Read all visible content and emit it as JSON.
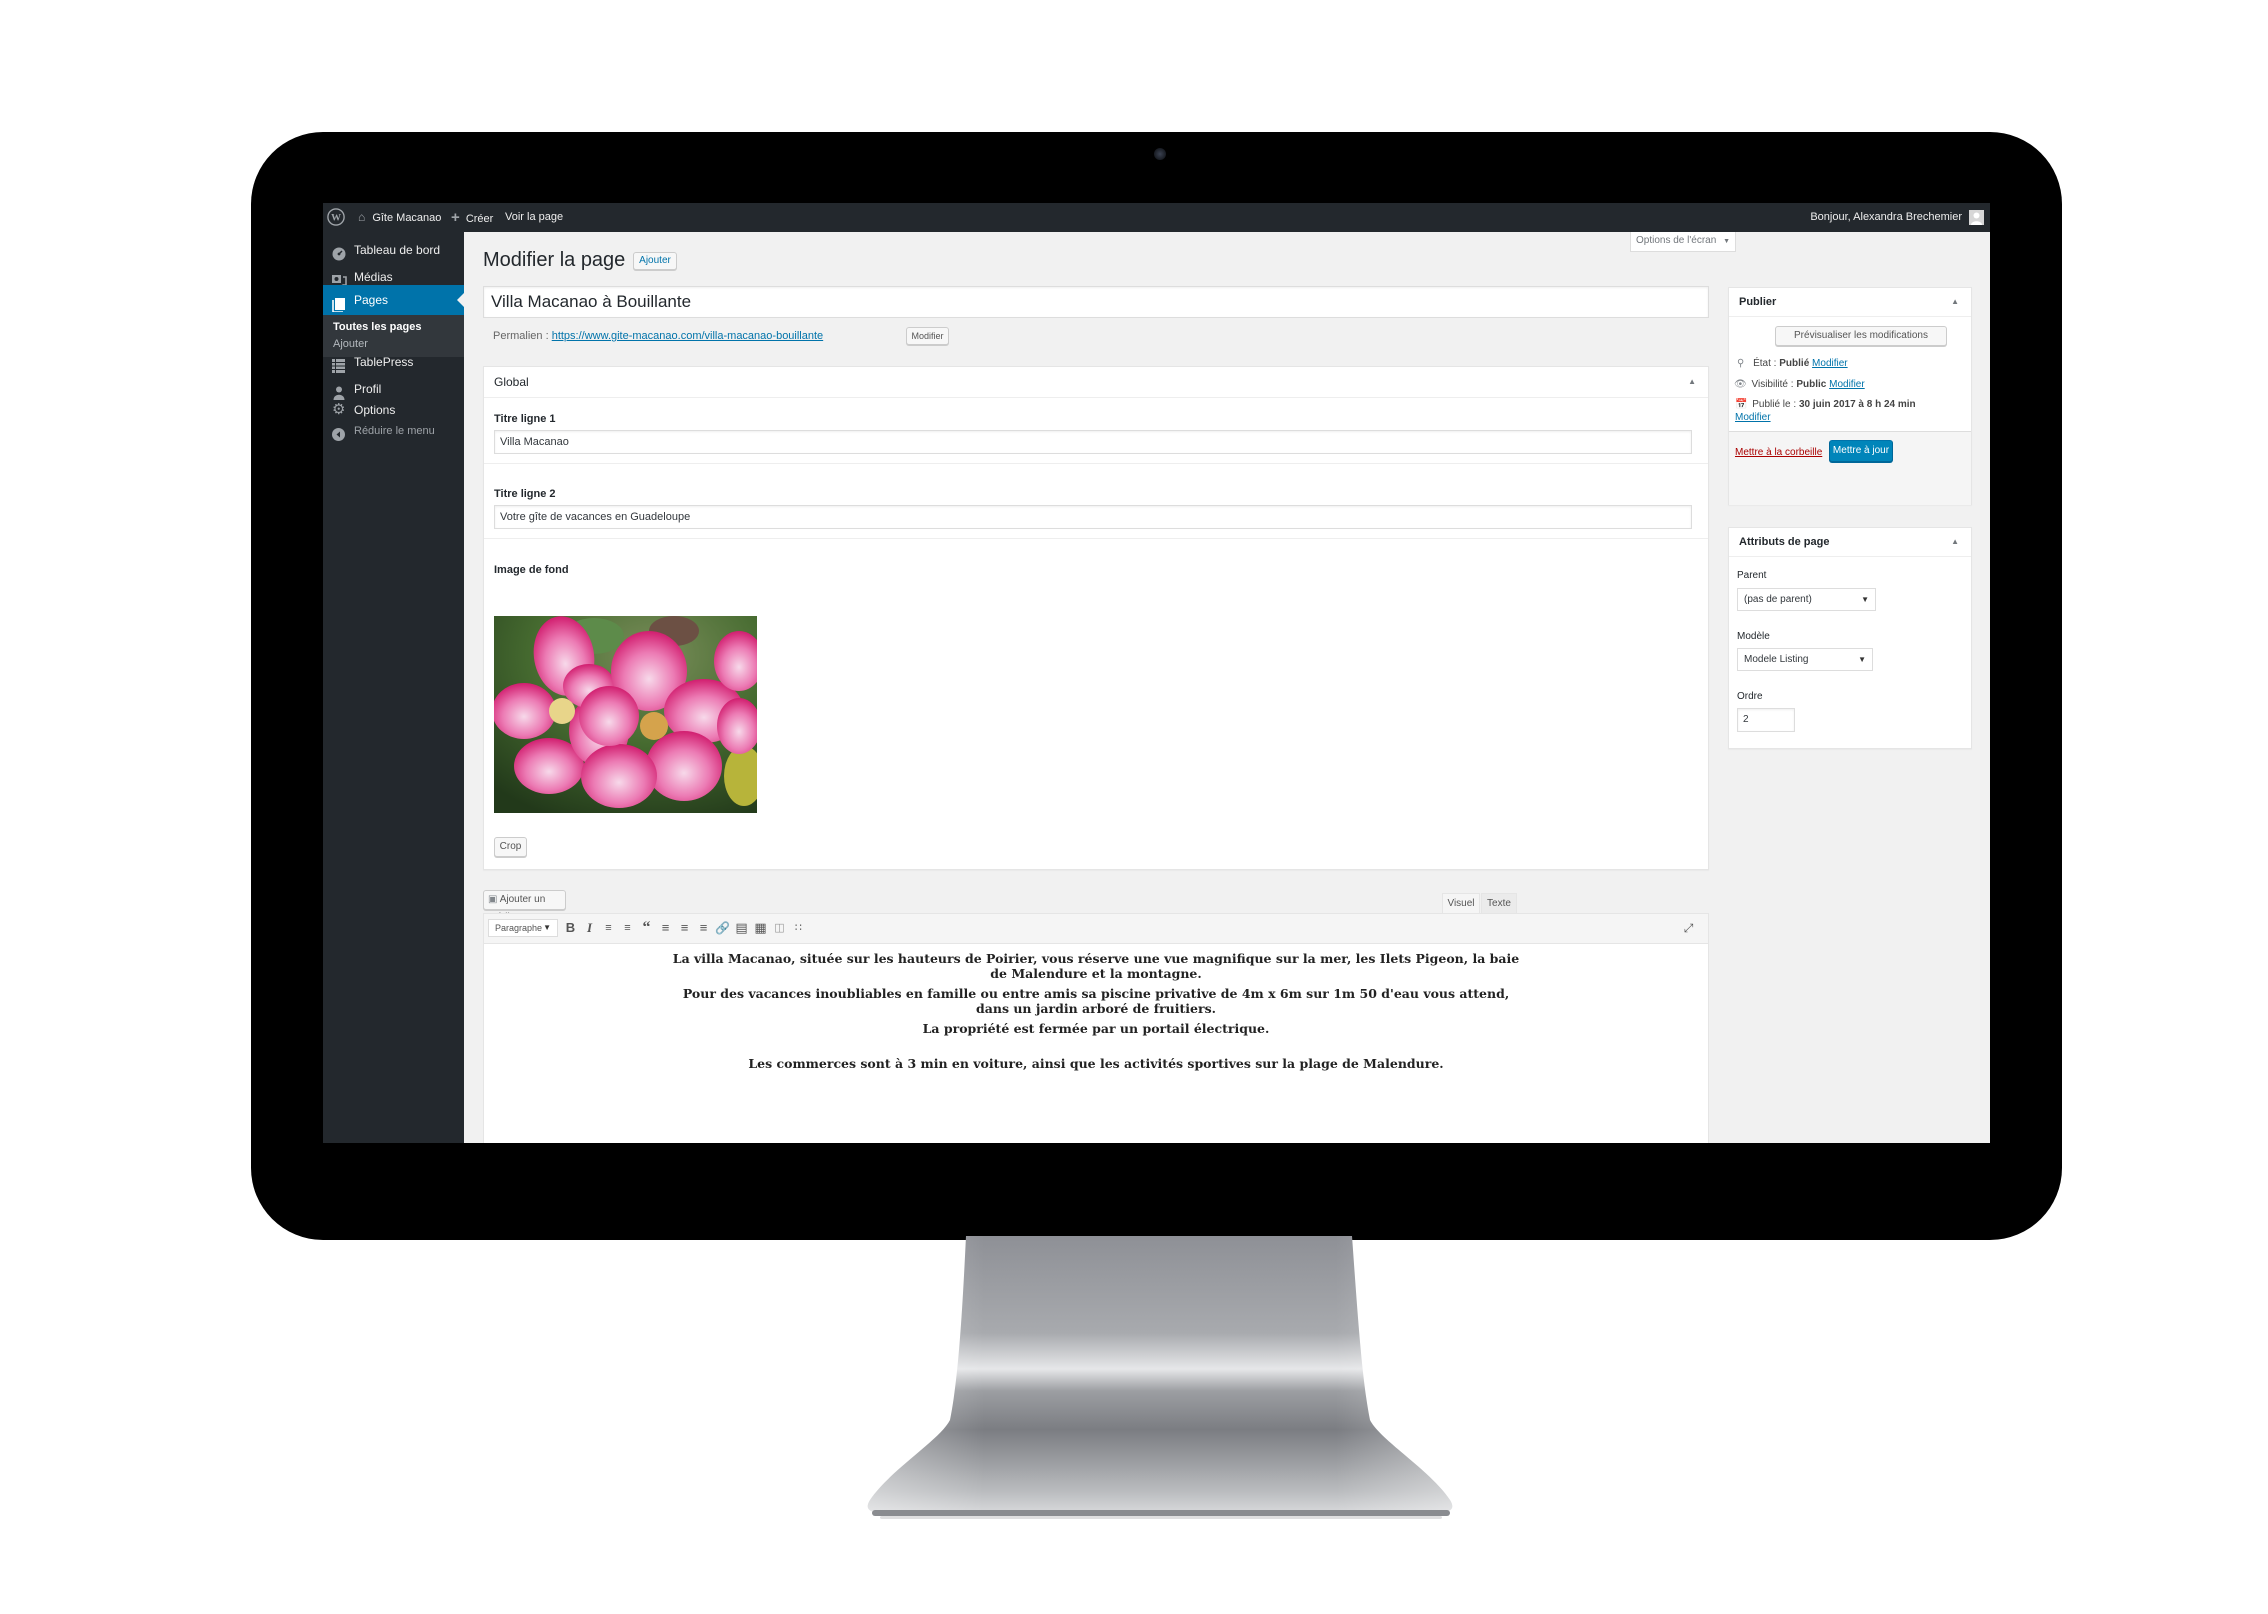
{
  "adminbar": {
    "site_name": "Gîte Macanao",
    "new_label": "Créer",
    "view_page": "Voir la page",
    "greeting": "Bonjour, Alexandra Brechemier",
    "icons": [
      "wordpress-logo",
      "home-icon",
      "plus-icon",
      "avatar"
    ]
  },
  "sidebar": {
    "items": [
      {
        "label": "Tableau de bord",
        "icon": "dashboard-icon"
      },
      {
        "label": "Médias",
        "icon": "media-icon"
      },
      {
        "label": "Pages",
        "icon": "pages-icon",
        "active": true
      },
      {
        "label": "TablePress",
        "icon": "table-icon"
      },
      {
        "label": "Profil",
        "icon": "user-icon"
      },
      {
        "label": "Options",
        "icon": "gear-icon"
      },
      {
        "label": "Réduire le menu",
        "icon": "collapse-icon"
      }
    ],
    "submenu": [
      {
        "label": "Toutes les pages",
        "current": true
      },
      {
        "label": "Ajouter"
      }
    ]
  },
  "header": {
    "title": "Modifier la page",
    "add_button": "Ajouter",
    "screen_options": "Options de l'écran"
  },
  "post": {
    "title_value": "Villa Macanao à Bouillante",
    "permalink_label": "Permalien :",
    "permalink_url": "https://www.gite-macanao.com/villa-macanao-bouillante",
    "permalink_edit": "Modifier"
  },
  "global_box": {
    "title": "Global",
    "fields": [
      {
        "label": "Titre ligne 1",
        "value": "Villa Macanao"
      },
      {
        "label": "Titre ligne 2",
        "value": "Votre gîte de vacances en Guadeloupe"
      }
    ],
    "image_label": "Image de fond",
    "image_alt": "Pink desert rose flowers",
    "crop_button": "Crop"
  },
  "editor": {
    "add_media": "Ajouter un média",
    "tabs": {
      "visual": "Visuel",
      "text": "Texte"
    },
    "format_select": "Paragraphe",
    "toolbar": [
      "bold",
      "italic",
      "bullet-list",
      "numbered-list",
      "blockquote",
      "align-left",
      "align-center",
      "align-right",
      "link",
      "read-more",
      "toolbar-toggle",
      "insert-table",
      "more"
    ],
    "paragraphs": [
      "La villa Macanao, située sur les hauteurs de Poirier, vous réserve une vue magnifique sur la mer, les Ilets Pigeon, la baie de Malendure et la montagne.",
      "Pour des vacances inoubliables en famille ou entre amis sa piscine privative de 4m x 6m sur 1m 50 d'eau vous attend, dans un jardin arboré de fruitiers.",
      "La propriété est fermée par un portail électrique.",
      "Les commerces sont à 3 min en voiture, ainsi que les activités sportives sur la plage de Malendure."
    ]
  },
  "publish_box": {
    "title": "Publier",
    "preview_button": "Prévisualiser les modifications",
    "status_label": "État :",
    "status_value": "Publié",
    "visibility_label": "Visibilité :",
    "visibility_value": "Public",
    "published_label": "Publié le :",
    "published_value": "30 juin 2017 à 8 h 24 min",
    "edit_link": "Modifier",
    "trash_link": "Mettre à la corbeille",
    "update_button": "Mettre à jour"
  },
  "attributes_box": {
    "title": "Attributs de page",
    "parent_label": "Parent",
    "parent_value": "(pas de parent)",
    "template_label": "Modèle",
    "template_value": "Modele Listing",
    "order_label": "Ordre",
    "order_value": "2"
  },
  "colors": {
    "adminbar": "#23282d",
    "accent": "#0073aa",
    "primary_button": "#0085ba",
    "trash": "#a00",
    "background": "#f1f1f1"
  }
}
